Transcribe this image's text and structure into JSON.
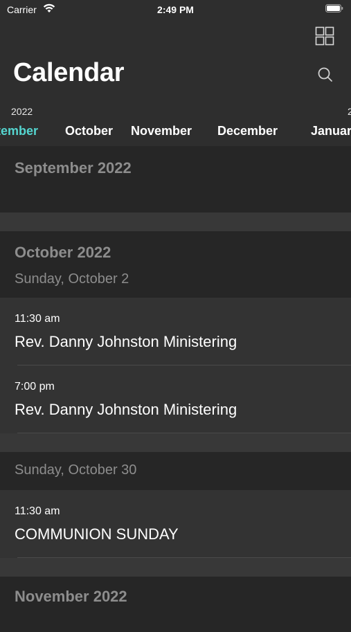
{
  "status_bar": {
    "carrier": "Carrier",
    "time": "2:49 PM"
  },
  "header": {
    "title": "Calendar",
    "grid_icon": "grid-icon",
    "search_icon": "search-icon"
  },
  "month_strip": {
    "accent_color": "#55d6d0",
    "items": [
      {
        "year": "2022",
        "label": "September",
        "selected": true
      },
      {
        "year": "",
        "label": "October",
        "selected": false
      },
      {
        "year": "",
        "label": "November",
        "selected": false
      },
      {
        "year": "",
        "label": "December",
        "selected": false
      },
      {
        "year": "2",
        "label": "January",
        "selected": false
      }
    ]
  },
  "sections": [
    {
      "month": "September 2022"
    },
    {
      "month": "October 2022",
      "days": [
        {
          "day": "Sunday, October 2",
          "events": [
            {
              "time": "11:30 am",
              "title": "Rev. Danny Johnston Ministering"
            },
            {
              "time": "7:00 pm",
              "title": "Rev. Danny Johnston Ministering"
            }
          ]
        },
        {
          "day": "Sunday, October 30",
          "events": [
            {
              "time": "11:30 am",
              "title": "COMMUNION SUNDAY"
            }
          ]
        }
      ]
    },
    {
      "month": "November 2022"
    }
  ]
}
